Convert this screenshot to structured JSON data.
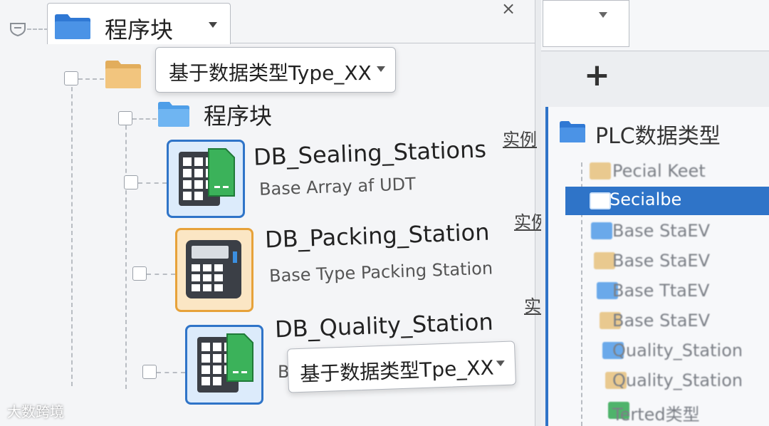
{
  "left_panel": {
    "tab": {
      "title": "程序块"
    },
    "close_label": "×",
    "folder_row": {
      "dropdown_value": "基于数据类型Type_XX"
    },
    "sub_folder": {
      "label": "程序块"
    },
    "blocks": [
      {
        "name": "DB_Sealing_Stations",
        "desc": "Base Array af UDT",
        "instance_label": "实例",
        "icon": "data-block-grid-icon",
        "accent": "#2f74c8"
      },
      {
        "name": "DB_Packing_Station",
        "desc": "Base Type Packing Station",
        "instance_label": "实例",
        "icon": "calculator-block-icon",
        "accent": "#e7a23a"
      },
      {
        "name": "DB_Quality_Station",
        "desc": "B",
        "instance_label": "实例",
        "icon": "data-block-grid-icon",
        "accent": "#2f74c8"
      }
    ],
    "bottom_dropdown": {
      "value": "基于数据类型Tpe_XX"
    }
  },
  "right_panel": {
    "add_label": "+",
    "section_title": "PLC数据类型",
    "items": [
      {
        "label": "Pecial Keet",
        "color": "#e9c98f",
        "selected": false
      },
      {
        "label": "Secialbe",
        "color": "#e9c98f",
        "selected": true
      },
      {
        "label": "Base StaEV",
        "color": "#6aa9ea",
        "selected": false
      },
      {
        "label": "Base StaEV",
        "color": "#e9c98f",
        "selected": false
      },
      {
        "label": "Base TtaEV",
        "color": "#6aa9ea",
        "selected": false
      },
      {
        "label": "Base StaEV",
        "color": "#e9c98f",
        "selected": false
      },
      {
        "label": "Quality_Station",
        "color": "#6aa9ea",
        "selected": false
      },
      {
        "label": "Quality_Station",
        "color": "#e9c98f",
        "selected": false
      },
      {
        "label": "Terted类型",
        "color": "#4fb36b",
        "selected": false
      }
    ]
  },
  "watermark": "大数跨境",
  "colors": {
    "accent_blue": "#2f74c8",
    "folder_yellow": "#e9c98f",
    "green": "#4fb36b"
  }
}
